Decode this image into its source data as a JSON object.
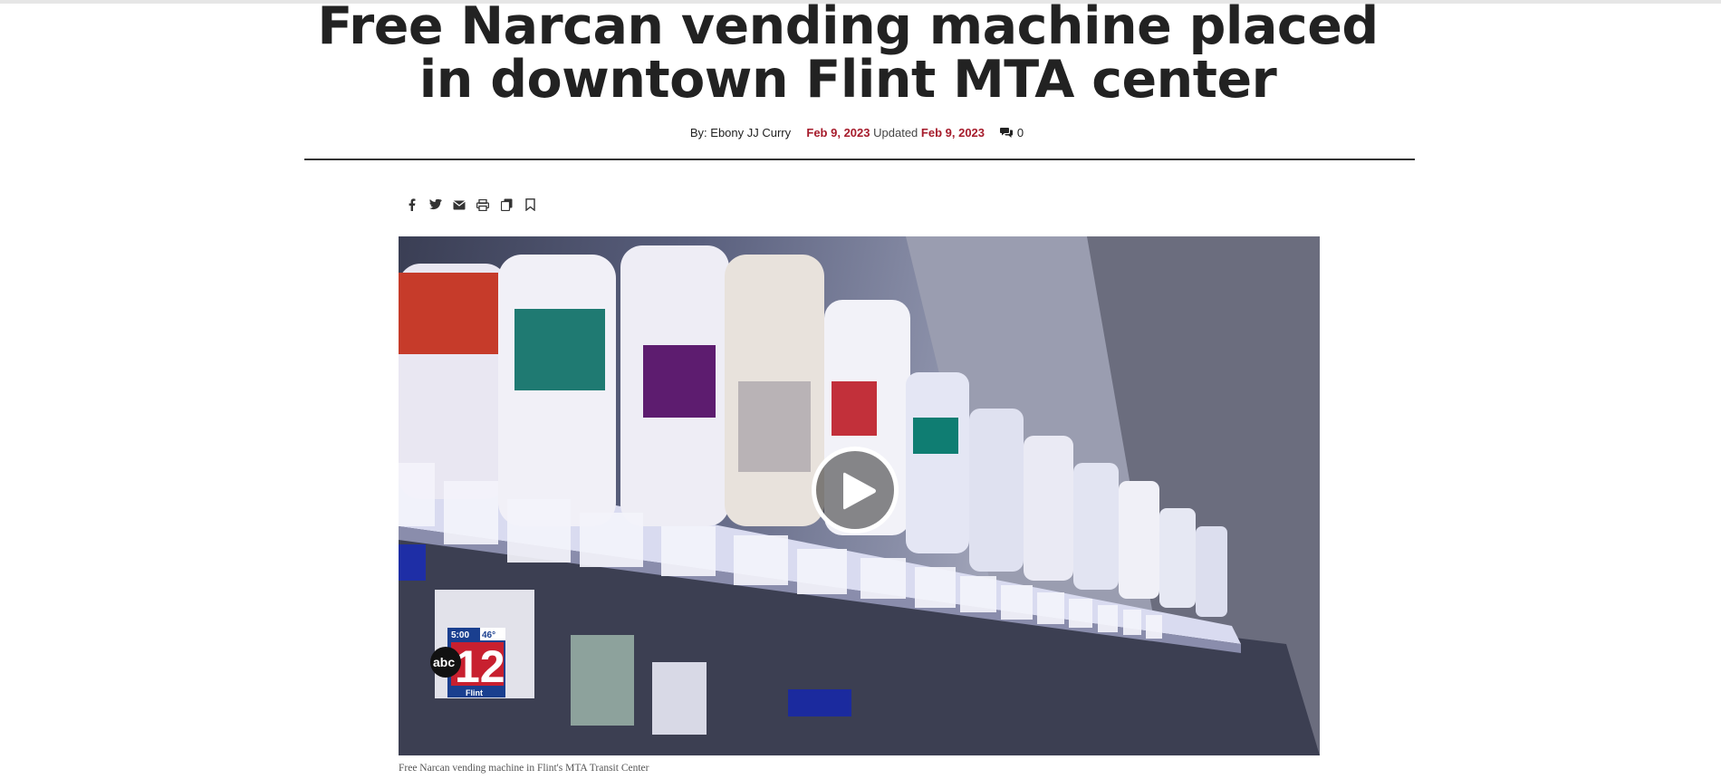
{
  "article": {
    "headline": "Free Narcan vending machine placed in downtown Flint MTA center",
    "byline": {
      "by_label": "By: Ebony JJ Curry",
      "published": "Feb 9, 2023",
      "updated_label": "Updated",
      "updated": "Feb 9, 2023",
      "comment_count": "0"
    }
  },
  "share_icons": [
    "facebook-icon",
    "twitter-icon",
    "email-icon",
    "print-icon",
    "copy-icon",
    "bookmark-icon"
  ],
  "video": {
    "logo": {
      "time": "5:00",
      "temp": "46°",
      "network": "abc",
      "channel": "12",
      "city": "Flint"
    },
    "caption": "Free Narcan vending machine in Flint's MTA Transit Center"
  },
  "colors": {
    "accent": "#a61b2b",
    "text": "#222222",
    "rule": "#333333"
  }
}
